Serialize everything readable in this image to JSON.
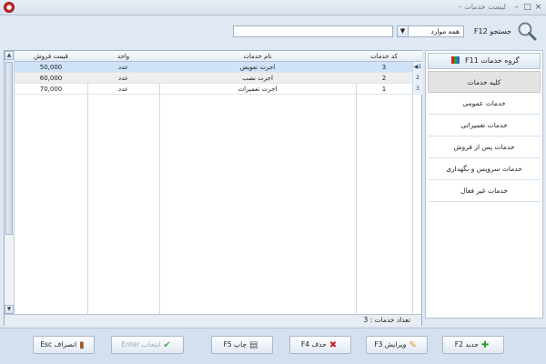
{
  "window": {
    "title": "لیست خدمات",
    "title_sep": "–",
    "app_icon": "app-icon",
    "controls": {
      "close": "×",
      "maximize": "□",
      "minimize": "–"
    }
  },
  "search": {
    "label": "جستجو F12",
    "scope_value": "همه موارد",
    "dropdown_arrow": "▼",
    "input_value": "",
    "icon": "magnifier-icon"
  },
  "groups": {
    "header": "گروه خدمات F11",
    "items": [
      "کلیه خدمات",
      "خدمات عمومی",
      "خدمات تعمیراتی",
      "خدمات پس از فروش",
      "خدمات سرویس و نگهداری",
      "خدمات غیر فعال"
    ],
    "selected_index": 0
  },
  "table": {
    "columns": [
      "کد خدمات",
      "نام خدمات",
      "واحد",
      "قیمت فروش"
    ],
    "rows": [
      {
        "code": "3",
        "name": "اجرت تعویض",
        "unit": "عدد",
        "price": "50,000",
        "row_no": "1",
        "marker": "◀"
      },
      {
        "code": "2",
        "name": "اجرت نصب",
        "unit": "عدد",
        "price": "60,000",
        "row_no": "2",
        "marker": ""
      },
      {
        "code": "1",
        "name": "اجرت تعمیرات",
        "unit": "عدد",
        "price": "70,000",
        "row_no": "3",
        "marker": ""
      }
    ],
    "count_label": "تعداد خدمات : 3",
    "scroll_up": "▲",
    "scroll_down": "▼"
  },
  "buttons": {
    "new": "جدید F2",
    "edit": "ویرایش F3",
    "delete": "حذف F4",
    "print": "چاپ F5",
    "select": "انتخاب Enter",
    "cancel": "انصراف Esc"
  },
  "colors": {
    "selected_row": "#cfe3f8",
    "alt_row": "#eeeeee",
    "background": "#dfe8f3"
  }
}
